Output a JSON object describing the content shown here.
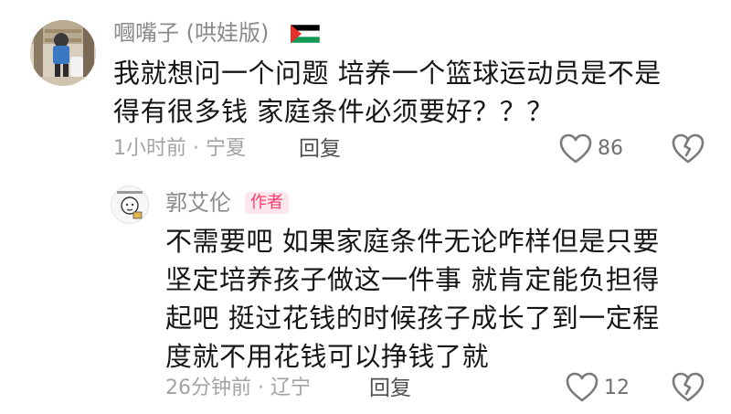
{
  "comment": {
    "username": "嘓嘴子 (哄娃版)",
    "flag_icon": "palestine-flag-icon",
    "text_lines": [
      "我就想问一个问题 培养一个篮球运动员是不是",
      "得有很多钱 家庭条件必须要好？？？"
    ],
    "meta": "1小时前 · 宁夏",
    "reply_label": "回复",
    "like_count": "86",
    "like_icon": "heart-icon",
    "dislike_icon": "broken-heart-icon"
  },
  "reply": {
    "username": "郭艾伦",
    "badge": "作者",
    "text_lines": [
      "不需要吧 如果家庭条件无论咋样但是只要",
      "坚定培养孩子做这一件事 就肯定能负担得",
      "起吧 挺过花钱的时候孩子成长了到一定程",
      "度就不用花钱可以挣钱了就"
    ],
    "meta": "26分钟前 · 辽宁",
    "reply_label": "回复",
    "like_count": "12",
    "like_icon": "heart-icon",
    "dislike_icon": "broken-heart-icon"
  },
  "colors": {
    "badge_text": "#ff3b6a",
    "badge_bg": "#fde6ec",
    "username": "#8a8a8a",
    "meta": "#a3a3a3"
  }
}
